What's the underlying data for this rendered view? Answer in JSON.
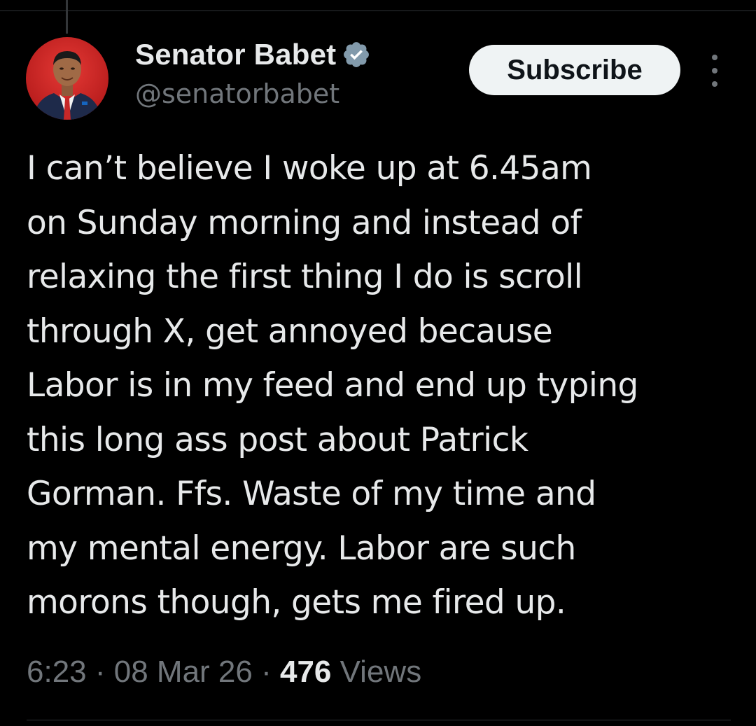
{
  "post": {
    "author": {
      "display_name": "Senator Babet",
      "handle": "@senatorbabet",
      "verified": true,
      "avatar_icon": "profile-photo"
    },
    "subscribe_label": "Subscribe",
    "more_icon": "more-vertical-icon",
    "text_lines": [
      "I can’t believe I woke up at 6.45am",
      "on Sunday morning and instead of",
      "relaxing the first thing I do is scroll",
      "through X, get annoyed because",
      "Labor is in my feed and end up typing",
      "this long ass post about Patrick",
      "Gorman. Ffs. Waste of my time and",
      "my mental energy. Labor are such",
      "morons though, gets me fired up."
    ],
    "time": "6:23",
    "separator": " · ",
    "date": "08 Mar 26",
    "views_count": "476",
    "views_label": " Views"
  },
  "colors": {
    "background": "#000000",
    "text_primary": "#e7e9ea",
    "text_secondary": "#71767b",
    "verified_badge": "#829aab",
    "button_bg": "#eff3f4",
    "divider": "#2f3336"
  }
}
